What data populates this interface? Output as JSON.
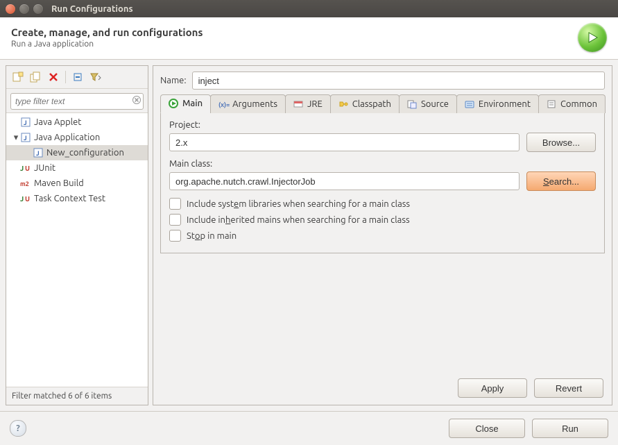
{
  "window": {
    "title": "Run Configurations"
  },
  "header": {
    "title": "Create, manage, and run configurations",
    "subtitle": "Run a Java application"
  },
  "left": {
    "filter_placeholder": "type filter text",
    "tree": [
      {
        "label": "Java Applet",
        "kind": "applet",
        "depth": 0,
        "expandable": false
      },
      {
        "label": "Java Application",
        "kind": "javaapp",
        "depth": 0,
        "expandable": true,
        "expanded": true
      },
      {
        "label": "New_configuration",
        "kind": "config",
        "depth": 1,
        "expandable": false,
        "selected": true
      },
      {
        "label": "JUnit",
        "kind": "junit",
        "depth": 0,
        "expandable": false
      },
      {
        "label": "Maven Build",
        "kind": "maven",
        "depth": 0,
        "expandable": false
      },
      {
        "label": "Task Context Test",
        "kind": "task",
        "depth": 0,
        "expandable": false
      }
    ],
    "status": "Filter matched 6 of 6 items"
  },
  "right": {
    "name_label": "Name:",
    "name_value": "inject",
    "tabs": [
      {
        "label": "Main",
        "active": true
      },
      {
        "label": "Arguments",
        "active": false
      },
      {
        "label": "JRE",
        "active": false
      },
      {
        "label": "Classpath",
        "active": false
      },
      {
        "label": "Source",
        "active": false
      },
      {
        "label": "Environment",
        "active": false
      },
      {
        "label": "Common",
        "active": false
      }
    ],
    "main": {
      "project_label": "Project:",
      "project_value": "2.x",
      "browse_label": "Browse...",
      "mainclass_label": "Main class:",
      "mainclass_value": "org.apache.nutch.crawl.InjectorJob",
      "search_label": "Search...",
      "chk_syslibs": "Include system libraries when searching for a main class",
      "chk_inherit": "Include inherited mains when searching for a main class",
      "chk_stop": "Stop in main"
    },
    "apply_label": "Apply",
    "revert_label": "Revert"
  },
  "footer": {
    "close_label": "Close",
    "run_label": "Run"
  }
}
